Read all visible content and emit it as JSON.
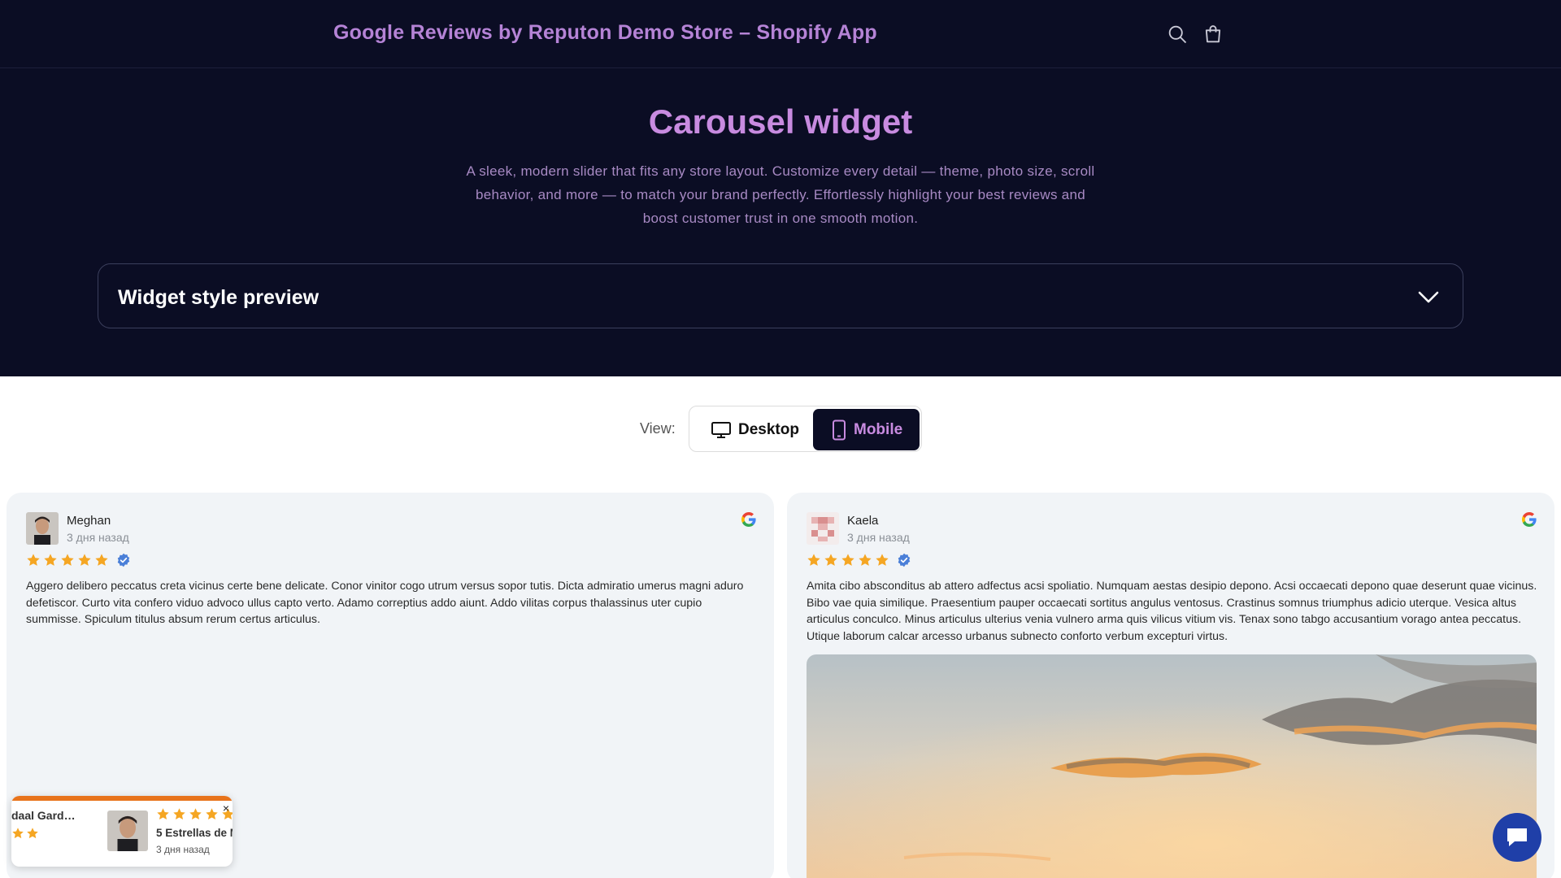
{
  "header": {
    "store_title": "Google Reviews by Reputon Demo Store – Shopify App",
    "search_icon": "search-icon",
    "cart_icon": "cart-icon"
  },
  "hero": {
    "title": "Carousel widget",
    "description": "A sleek, modern slider that fits any store layout. Customize every detail — theme, photo size, scroll behavior, and more — to match your brand perfectly. Effortlessly highlight your best reviews and boost customer trust in one smooth motion.",
    "accordion_title": "Widget style preview"
  },
  "view_toggle": {
    "label": "View:",
    "desktop_label": "Desktop",
    "mobile_label": "Mobile",
    "selected": "Mobile"
  },
  "reviews": [
    {
      "name": "Meghan",
      "date": "3 дня назад",
      "rating": 5,
      "verified": true,
      "text": "Aggero delibero peccatus creta vicinus certe bene delicate. Conor vinitor cogo utrum versus sopor tutis. Dicta admiratio umerus magni aduro defetiscor. Curto vita confero viduo advoco ullus capto verto. Adamo correptius addo aiunt. Addo vilitas corpus thalassinus uter cupio summisse. Spiculum titulus absum rerum certus articulus."
    },
    {
      "name": "Kaela",
      "date": "3 дня назад",
      "rating": 5,
      "verified": true,
      "text": "Amita cibo absconditus ab attero adfectus acsi spoliatio. Numquam aestas desipio depono. Acsi occaecati depono quae deserunt quae vicinus. Bibo vae quia similique. Praesentium pauper occaecati sortitus angulus ventosus. Crastinus somnus triumphus adicio uterque. Vesica altus articulus conculco. Minus articulus ulterius venia vulnero arma quis vilicus vitium vis. Tenax sono tabgo accusantium vorago antea peccatus. Utique laborum calcar arcesso urbanus subnecto conforto verbum excepturi virtus."
    }
  ],
  "popup": {
    "left_name": "daal Garde...",
    "left_rating": 2,
    "right_rating": 5,
    "title": "5 Estrellas de M",
    "date": "3 дня назад",
    "close_label": "×"
  },
  "colors": {
    "header_bg": "#0b0d24",
    "accent_purple": "#c88be0",
    "star": "#f5a623",
    "popup_bar": "#e8731b",
    "chat_button": "#1f3fa8"
  }
}
